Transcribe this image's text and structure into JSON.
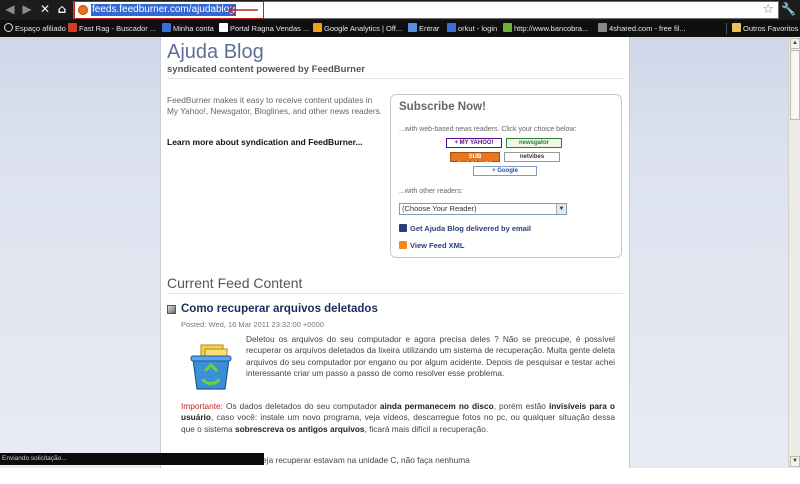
{
  "browser": {
    "url": "feeds.feedburner.com/ajudablog",
    "bookmarks": [
      {
        "label": "Espaço afiliado",
        "color": "#e8e8e8"
      },
      {
        "label": "Fast Rag - Buscador ...",
        "color": "#d23b2c"
      },
      {
        "label": "Minha conta",
        "color": "#3b6fd4"
      },
      {
        "label": "Portal Ragna Vendas ...",
        "color": "#ffffff"
      },
      {
        "label": "Google Analytics | Off...",
        "color": "#f0a21c"
      },
      {
        "label": "Entrar",
        "color": "#5a8de0"
      },
      {
        "label": "orkut - login",
        "color": "#3b6fd4"
      },
      {
        "label": "http://www.bancobra...",
        "color": "#6bb23a"
      },
      {
        "label": "4shared.com - free fil...",
        "color": "#888888"
      }
    ],
    "other_bookmarks": "Outros Favoritos",
    "status": "Enviando solicitação..."
  },
  "page": {
    "title": "Ajuda Blog",
    "subtitle": "syndicated content powered by FeedBurner",
    "intro": "FeedBurner makes it easy to receive content updates in My Yahoo!, Newsgator, Bloglines, and other news readers.",
    "learn_more": "Learn more about syndication and FeedBurner...",
    "subscribe": {
      "title": "Subscribe Now!",
      "hint_web": "...with web-based news readers. Click your choice below:",
      "badges": {
        "myyahoo": "+ MY YAHOO!",
        "newsgator": "newsgator",
        "bloglines": "SUB BLOGLINES",
        "netvibes": "netvibes",
        "google": "+ Google"
      },
      "hint_other": "...with other readers:",
      "select_value": "(Choose Your Reader)",
      "email_link": "Get Ajuda Blog delivered by email",
      "xml_link": "View Feed XML"
    },
    "feed_heading": "Current Feed Content",
    "post": {
      "title": "Como recuperar arquivos deletados",
      "date": "Posted: Wed, 16 Mar 2011 23:32:00 +0000",
      "para1": "Deletou os arquivos do seu computador e agora precisa deles ? Não se preocupe, é possível recuperar os arquivos deletados da lixeira utilizando um sistema de recuperação. Muita gente deleta arquivos do seu computador por engano ou por algum acidente. Depois de pesquisar e testar achei interessante criar um passo a passo de como resolver esse problema.",
      "para2": {
        "label": "Importante",
        "t1": ": Os dados deletados do seu computador ",
        "b1": "ainda permanecem no disco",
        "t2": ", porém estão ",
        "b2": "invisíveis para o usuário",
        "t3": ", caso você: instale um novo programa, veja vídeos, descarregue fotos no pc, ou qualquer situação dessa que o sistema ",
        "b3": "sobrescreva os antigos arquivos",
        "t4": ", ficará mais difícil a recuperação."
      },
      "para3": "e os arquivos que deseja recuperar estavam na unidade C, não faça nenhuma"
    }
  }
}
